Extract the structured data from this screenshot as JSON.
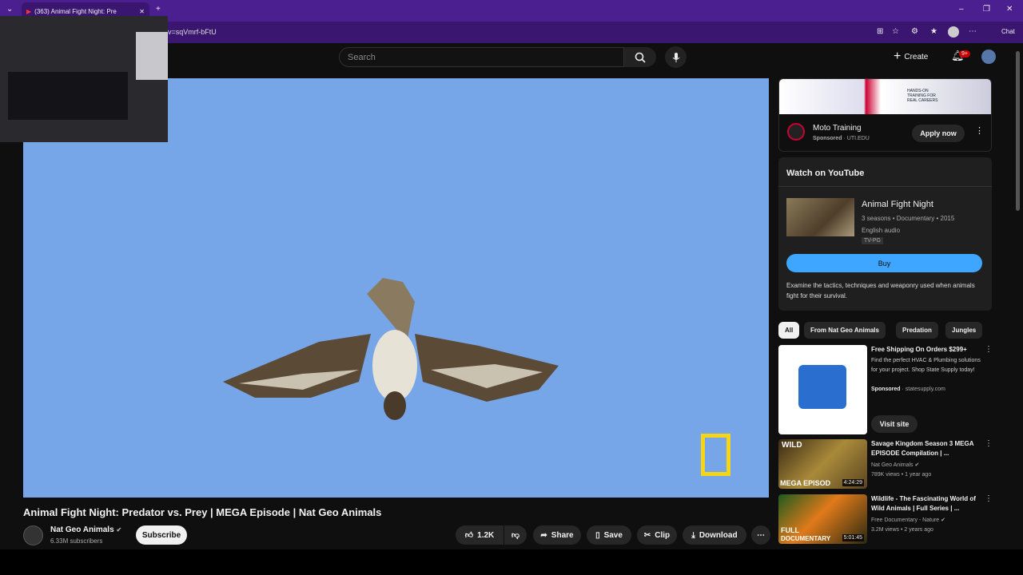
{
  "browser": {
    "tab_title": "(363) Animal Fight Night: Pre",
    "url": "v=sqVmrf-bFtU",
    "chat_label": "Chat"
  },
  "header": {
    "search_placeholder": "Search",
    "create_label": "Create",
    "notification_count": "9+"
  },
  "video": {
    "title": "Animal Fight Night: Predator vs. Prey | MEGA Episode | Nat Geo Animals",
    "channel": "Nat Geo Animals",
    "subscribers": "6.33M subscribers",
    "subscribe_label": "Subscribe",
    "likes": "1.2K",
    "share_label": "Share",
    "save_label": "Save",
    "clip_label": "Clip",
    "download_label": "Download"
  },
  "ad": {
    "title": "Moto Training",
    "sponsored": "Sponsored",
    "domain": "UTI.EDU",
    "cta": "Apply now",
    "banner_text": "HANDS-ON TRAINING FOR REAL CAREERS"
  },
  "watch_panel": {
    "heading": "Watch on YouTube",
    "show_title": "Animal Fight Night",
    "meta": "3 seasons • Documentary • 2015",
    "audio": "English audio",
    "rating": "TV-PG",
    "buy_label": "Buy",
    "description": "Examine the tactics, techniques and weaponry used when animals fight for their survival."
  },
  "chips": [
    "All",
    "From Nat Geo Animals",
    "Predation",
    "Jungles"
  ],
  "recommendations": [
    {
      "title": "Free Shipping On Orders $299+",
      "body": "Find the perfect HVAC & Plumbing solutions for your project. Shop State Supply today!",
      "sponsored": "Sponsored",
      "domain": "statesupply.com",
      "cta": "Visit site"
    },
    {
      "title": "Savage Kingdom Season 3 MEGA EPISODE Compilation | ...",
      "channel": "Nat Geo Animals",
      "meta": "789K views • 1 year ago",
      "duration": "4:24:29",
      "thumb_text_top": "WILD",
      "thumb_text_bottom": "MEGA EPISOD"
    },
    {
      "title": "Wildlife - The Fascinating World of Wild Animals | Full Series | ...",
      "channel": "Free Documentary - Nature",
      "meta": "3.2M views • 2 years ago",
      "duration": "5:01:45",
      "thumb_text_top": "FULL",
      "thumb_text_bottom": "DOCUMENTARY"
    }
  ],
  "colors": {
    "titlebar": "#4b1f8f",
    "accent_buy": "#3ea6ff",
    "sky": "#76a6e8",
    "natgeo_yellow": "#f5d617"
  }
}
